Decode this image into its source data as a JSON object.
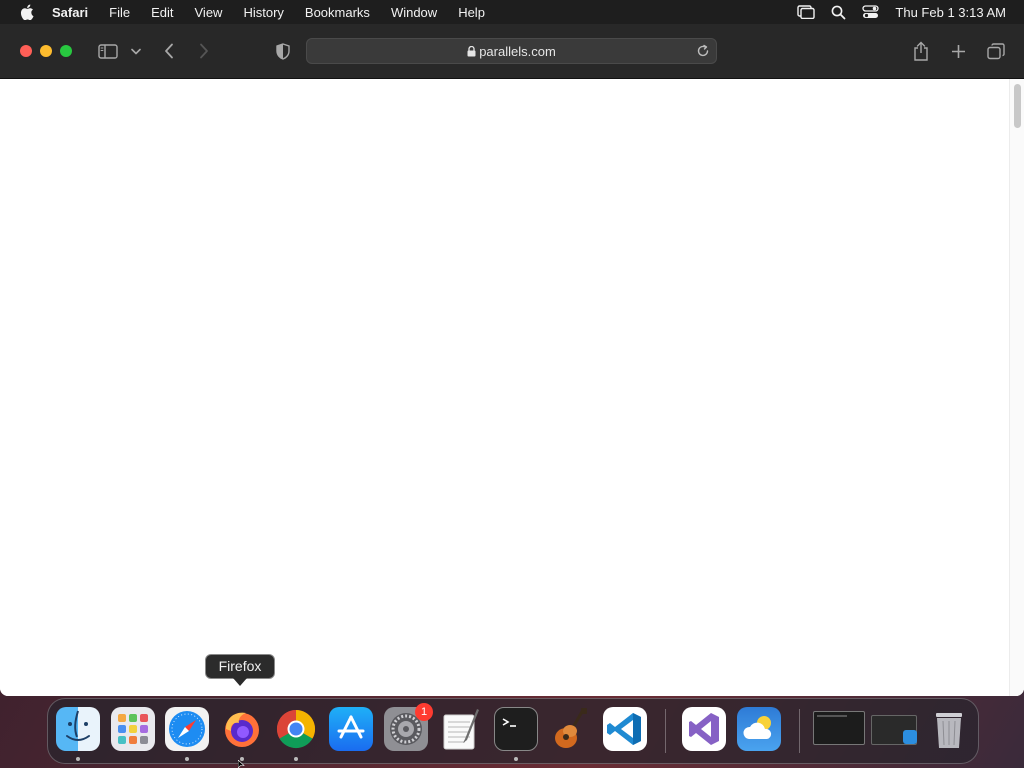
{
  "menubar": {
    "app_name": "Safari",
    "items": [
      "File",
      "Edit",
      "View",
      "History",
      "Bookmarks",
      "Window",
      "Help"
    ],
    "clock": "Thu Feb 1  3:13 AM"
  },
  "toolbar": {
    "url": "parallels.com"
  },
  "dock": {
    "tooltip": "Firefox",
    "badge_settings": "1",
    "apps": [
      "finder-icon",
      "launchpad-icon",
      "safari-icon",
      "firefox-icon",
      "chrome-icon",
      "app-store-icon",
      "system-settings-icon",
      "textedit-icon",
      "terminal-icon",
      "garageband-icon",
      "vscode-icon",
      "visual-studio-icon",
      "weather-icon",
      "minimized-window",
      "parallels-window",
      "trash-icon"
    ]
  },
  "colors": {
    "close": "#ff5f57",
    "minimize": "#febc2e",
    "maximize": "#28c840",
    "badge": "#ff3b30"
  }
}
